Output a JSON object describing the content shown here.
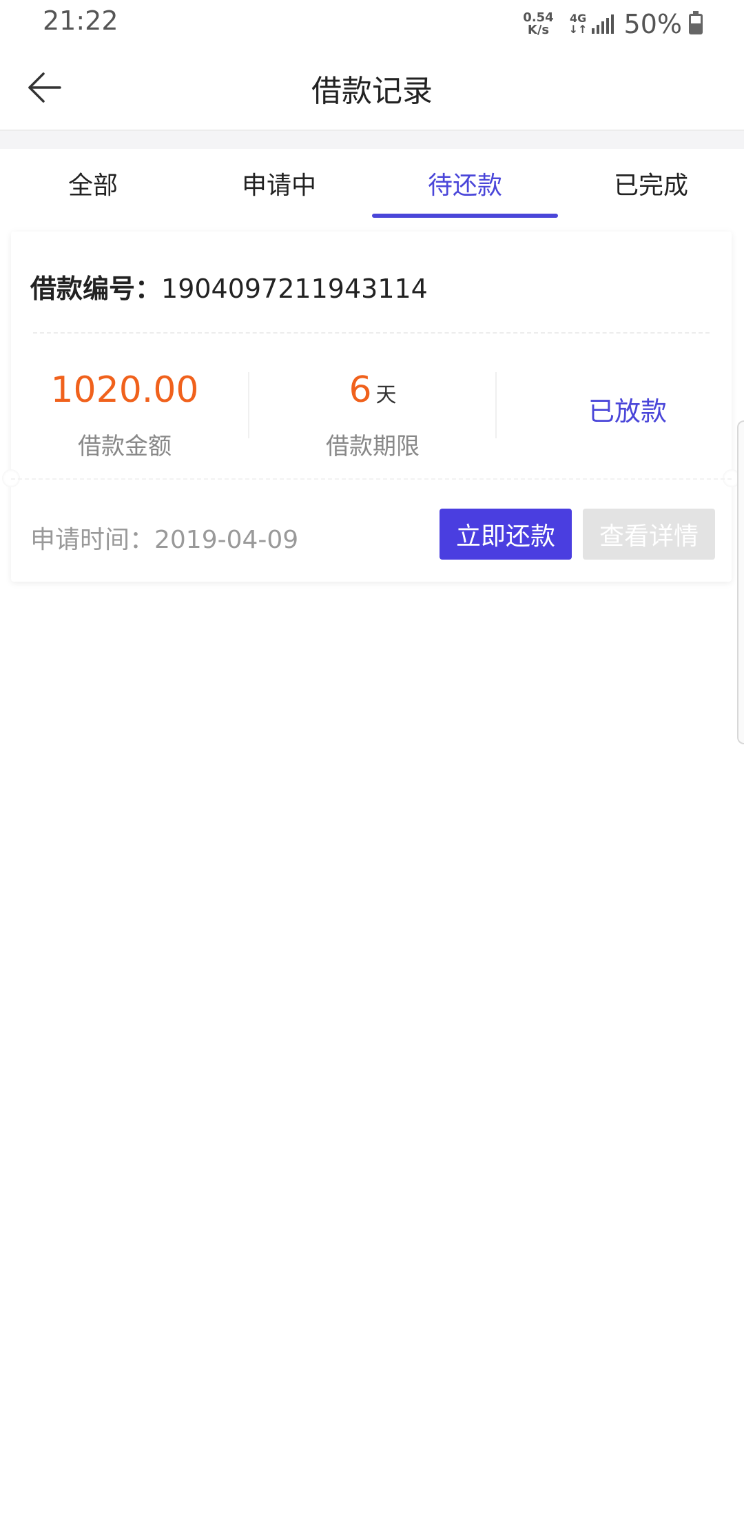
{
  "status_bar": {
    "time": "21:22",
    "net_speed_value": "0.54",
    "net_speed_unit": "K/s",
    "network_type": "4G",
    "network_arrows": "↓↑",
    "battery_text": "50%"
  },
  "header": {
    "title": "借款记录"
  },
  "tabs": [
    {
      "label": "全部"
    },
    {
      "label": "申请中"
    },
    {
      "label": "待还款"
    },
    {
      "label": "已完成"
    }
  ],
  "active_tab": "待还款",
  "card": {
    "loan_no_label": "借款编号：",
    "loan_no_value": "1904097211943114",
    "amount_value": "1020.00",
    "amount_label": "借款金额",
    "term_value": "6",
    "term_unit": "天",
    "term_label": "借款期限",
    "status": "已放款",
    "apply_time": "申请时间：2019-04-09",
    "repay_button": "立即还款",
    "detail_button": "查看详情"
  },
  "colors": {
    "accent": "#4a46d9",
    "amount": "#f0611c",
    "disabled_button": "#e3e3e3"
  },
  "icons": {
    "back": "arrow-left-icon",
    "signal": "signal-icon",
    "battery": "battery-icon"
  }
}
